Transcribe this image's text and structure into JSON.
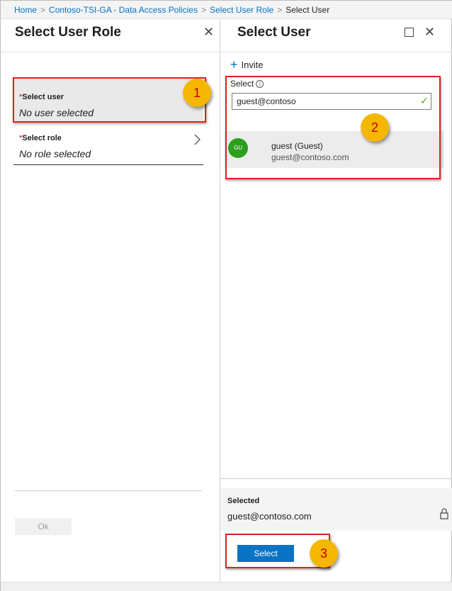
{
  "breadcrumb": {
    "items": [
      "Home",
      "Contoso-TSI-GA - Data Access Policies",
      "Select User Role",
      "Select User"
    ],
    "separator": ">"
  },
  "left_blade": {
    "title": "Select User Role",
    "close_glyph": "✕",
    "fields": [
      {
        "required_mark": "*",
        "label": "Select user",
        "value": "No user selected"
      },
      {
        "required_mark": "*",
        "label": "Select role",
        "value": "No role selected"
      }
    ],
    "ok_label": "Ok"
  },
  "right_blade": {
    "title": "Select User",
    "close_glyph": "✕",
    "invite_label": "Invite",
    "select_label": "Select",
    "search_value": "guest@contoso",
    "result": {
      "avatar_initials": "GU",
      "avatar_color": "#2ca01c",
      "name": "guest (Guest)",
      "email": "guest@contoso.com"
    },
    "selected_label": "Selected",
    "selected_value": "guest@contoso.com",
    "select_button_label": "Select"
  },
  "annotations": {
    "badges": [
      "1",
      "2",
      "3"
    ],
    "highlight_color": "#e02020",
    "badge_color": "#f5b700"
  },
  "colors": {
    "accent": "#0072c6",
    "primary_button": "#0a73c4",
    "check": "#57a300"
  }
}
